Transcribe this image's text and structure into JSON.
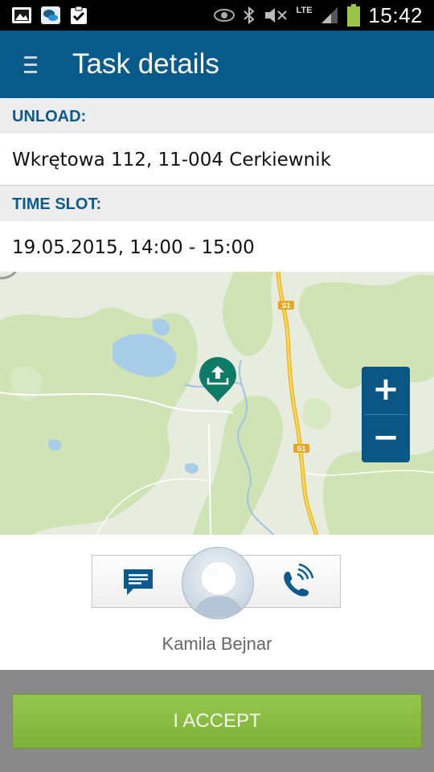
{
  "status_bar": {
    "time": "15:42",
    "network": "LTE",
    "icons": [
      "gallery-icon",
      "chat-app-icon",
      "clipboard-check-icon",
      "eye-icon",
      "bluetooth-icon",
      "mute-icon",
      "signal-icon",
      "battery-icon"
    ]
  },
  "app_bar": {
    "title": "Task details",
    "menu_icon": "hamburger-menu-icon",
    "color": "#075a8a"
  },
  "unload": {
    "label": "UNLOAD:",
    "value": "Wkrętowa 112, 11-004 Cerkiewnik"
  },
  "time_slot": {
    "label": "TIME SLOT:",
    "value": "19.05.2015, 14:00 - 15:00"
  },
  "map": {
    "road_label_1": "S1",
    "road_label_2": "S1",
    "marker_icon": "unload-pin-icon",
    "zoom_in": "+",
    "zoom_out": "−"
  },
  "contact": {
    "name": "Kamila Bejnar",
    "message_icon": "message-icon",
    "call_icon": "phone-call-icon",
    "avatar_icon": "avatar-placeholder-icon"
  },
  "actions": {
    "accept_label": "I ACCEPT",
    "accept_color": "#8bbd45"
  }
}
